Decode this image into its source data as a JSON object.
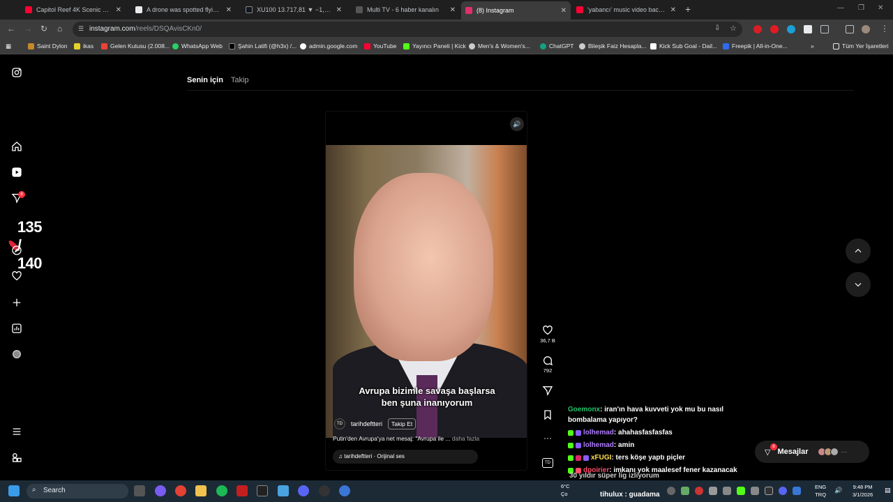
{
  "tabs": [
    {
      "label": "Capitol Reef 4K Scenic Drive | U",
      "color": "#ff0033",
      "active": false
    },
    {
      "label": "A drone was spotted flying in t",
      "color": "#e8eaed",
      "active": false
    },
    {
      "label": "XU100 13.717,81 ▼ −1,16%",
      "color": "#131722",
      "active": false
    },
    {
      "label": "Multi TV - 6 haber kanalın",
      "color": "#555",
      "active": false
    },
    {
      "label": "(8) Instagram",
      "color": "#e1306c",
      "active": true
    },
    {
      "label": "'yabancı' music video backstag",
      "color": "#ff0033",
      "active": false
    }
  ],
  "address": {
    "domain": "instagram.com",
    "path": "/reels/DSQAvisCKn0/"
  },
  "bookmarks": [
    "Saint Dylon",
    "ikas",
    "Gelen Kutusu (2.008...",
    "WhatsApp Web",
    "Şahin Latifi (@h3x) /...",
    "admin.google.com",
    "YouTube",
    "Yayıncı Paneli | Kick",
    "Men's & Women's...",
    "ChatGPT",
    "Bileşik Faiz Hesapla...",
    "Kick Sub Goal - Dail...",
    "Freepik | All-in-One..."
  ],
  "bookmarks_all": "Tüm Yer İşaretleri",
  "feed": {
    "for_you": "Senin için",
    "following": "Takip"
  },
  "sidebar": {
    "notif_count": "8"
  },
  "counter": "135 / 140",
  "video": {
    "subtitle_line1": "Avrupa bizimle savaşa başlarsa",
    "subtitle_line2": "ben şuna inanıyorum",
    "author": "tarihdeftteri",
    "author_badge": "TD",
    "follow": "Takip Et",
    "caption": "Putin'den Avrupa'ya net mesaj: \"Avrupa ile ...",
    "more": "daha fazla",
    "audio": "tarihdeftteri · Orijinal ses"
  },
  "actions": {
    "likes": "36,7 B",
    "comments": "792",
    "mini_badge": "TD"
  },
  "chat": [
    {
      "user": "Goemonx",
      "text": ": iran'ın hava kuvveti yok mu bu nasıl",
      "color": "#25c26b"
    },
    {
      "user": "",
      "text": "bombalama yapıyor?",
      "color": "#fff"
    },
    {
      "user": "lolhemad",
      "text": ": ahahasfasfasfas",
      "color": "#b17cff"
    },
    {
      "user": "lolhemad",
      "text": ": amin",
      "color": "#b17cff"
    },
    {
      "user": "xFUGI",
      "text": ": ters köşe yaptı piçler",
      "color": "#ffe14d"
    },
    {
      "user": "dpoirier",
      "text": ": imkanı yok maalesef fener kazanacak",
      "color": "#ff4d6a"
    }
  ],
  "chat_extra": [
    "30 yıldır süper lig izliyorum",
    "tihulux : guadama"
  ],
  "messages": {
    "label": "Mesajlar",
    "count": "8"
  },
  "taskbar": {
    "search": "Search",
    "weather": "6°C",
    "weather_sub": "Ço",
    "lang1": "ENG",
    "lang2": "TRQ",
    "time": "9:48 PM",
    "date": "3/1/2026"
  }
}
